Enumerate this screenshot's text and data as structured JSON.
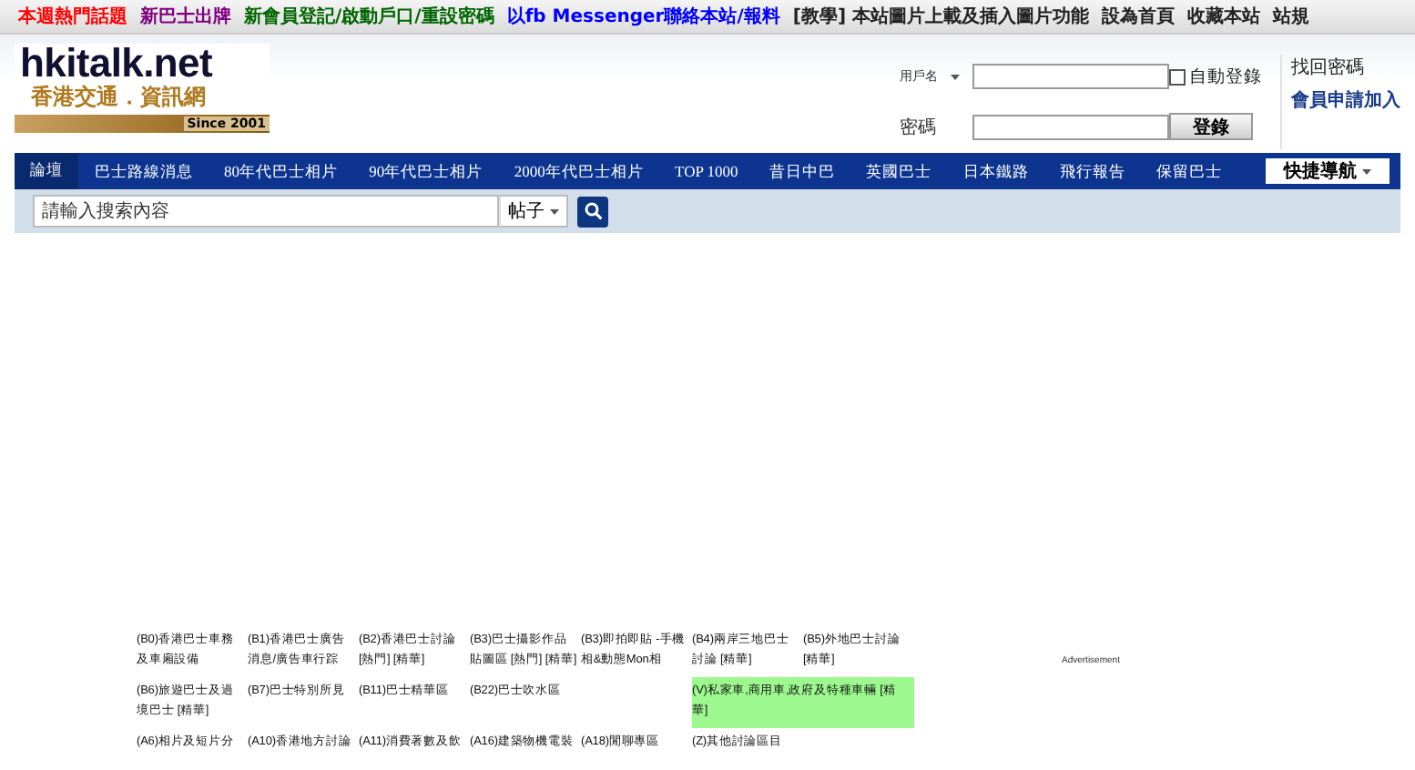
{
  "top_links": [
    {
      "label": "本週熱門話題",
      "color": "#ff0000"
    },
    {
      "label": "新巴士出牌",
      "color": "#800080"
    },
    {
      "label": "新會員登記/啟動戶口/重設密碼",
      "color": "#006600"
    },
    {
      "label": "以fb Messenger聯絡本站/報料",
      "color": "#0000ff"
    },
    {
      "label": "[教學] 本站圖片上載及插入圖片功能",
      "color": "#222222"
    },
    {
      "label": "設為首頁",
      "color": "#222222"
    },
    {
      "label": "收藏本站",
      "color": "#222222"
    },
    {
      "label": "站規",
      "color": "#222222"
    }
  ],
  "logo": {
    "name": "hkitalk.net",
    "subtitle": "香港交通．資訊網",
    "since": "Since 2001"
  },
  "login": {
    "username_label": "用戶名",
    "password_label": "密碼",
    "remember_label": "自動登錄",
    "remember_checked": false,
    "login_button": "登錄",
    "forgot_link": "找回密碼",
    "register_link": "會員申請加入"
  },
  "nav": [
    {
      "label": "論壇",
      "selected": true
    },
    {
      "label": "巴士路線消息",
      "selected": false
    },
    {
      "label": "80年代巴士相片",
      "selected": false
    },
    {
      "label": "90年代巴士相片",
      "selected": false
    },
    {
      "label": "2000年代巴士相片",
      "selected": false
    },
    {
      "label": "TOP 1000",
      "selected": false
    },
    {
      "label": "昔日中巴",
      "selected": false
    },
    {
      "label": "英國巴士",
      "selected": false
    },
    {
      "label": "日本鐵路",
      "selected": false
    },
    {
      "label": "飛行報告",
      "selected": false
    },
    {
      "label": "保留巴士",
      "selected": false
    }
  ],
  "quick_nav": "快捷導航",
  "search": {
    "placeholder": "請輸入搜索內容",
    "scope": "帖子"
  },
  "forums": [
    {
      "label": "(B0)香港巴士車務及車廂設備",
      "highlighted": false
    },
    {
      "label": "(B1)香港巴士廣告消息/廣告車行踪",
      "highlighted": false
    },
    {
      "label": "(B2)香港巴士討論 [熱門] [精華]",
      "highlighted": false
    },
    {
      "label": "(B3)巴士攝影作品貼圖區 [熱門] [精華]",
      "highlighted": false
    },
    {
      "label": "(B3)即拍即貼 -手機相&動態Mon相",
      "highlighted": false
    },
    {
      "label": "(B4)兩岸三地巴士討論 [精華]",
      "highlighted": false
    },
    {
      "label": "(B5)外地巴士討論 [精華]",
      "highlighted": false
    },
    {
      "label": "(B6)旅遊巴士及過境巴士 [精華]",
      "highlighted": false
    },
    {
      "label": "(B7)巴士特別所見",
      "highlighted": false
    },
    {
      "label": "(B11)巴士精華區",
      "highlighted": false
    },
    {
      "label": "(B22)巴士吹水區",
      "highlighted": false
    },
    {
      "label": "(V)私家車,商用車,政府及特種車輛 [精華]",
      "highlighted": true
    },
    {
      "label": "(A6)相片及短片分",
      "highlighted": false
    },
    {
      "label": "(A10)香港地方討論",
      "highlighted": false
    },
    {
      "label": "(A11)消費著數及飲",
      "highlighted": false
    },
    {
      "label": "(A16)建築物機電裝",
      "highlighted": false
    },
    {
      "label": "(A18)閒聊專區",
      "highlighted": false
    },
    {
      "label": "(Z)其他討論區目",
      "highlighted": false
    }
  ],
  "ad_label": "Advertisement"
}
